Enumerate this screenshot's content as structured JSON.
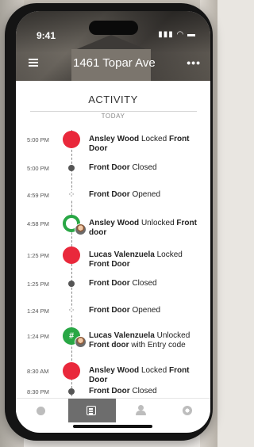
{
  "status_bar": {
    "time": "9:41",
    "icons": "▮▮▮ ◠ ▬"
  },
  "header": {
    "address": "1461 Topar Ave",
    "more": "•••"
  },
  "activity": {
    "title": "ACTIVITY",
    "section_label": "TODAY",
    "events": [
      {
        "time": "5:00 PM",
        "actor": "Ansley Wood",
        "action": "Locked",
        "target": "Front Door",
        "marker": "red"
      },
      {
        "time": "5:00 PM",
        "target": "Front Door",
        "action": "Closed",
        "marker": "small-dot"
      },
      {
        "time": "4:59 PM",
        "target": "Front Door",
        "action": "Opened",
        "marker": "dotted"
      },
      {
        "time": "4:58 PM",
        "actor": "Ansley Wood",
        "action": "Unlocked",
        "target": "Front door",
        "marker": "green-ring"
      },
      {
        "time": "1:25 PM",
        "actor": "Lucas Valenzuela",
        "action": "Locked",
        "target": "Front Door",
        "marker": "red"
      },
      {
        "time": "1:25 PM",
        "target": "Front Door",
        "action": "Closed",
        "marker": "small-dot"
      },
      {
        "time": "1:24 PM",
        "target": "Front Door",
        "action": "Opened",
        "marker": "dotted"
      },
      {
        "time": "1:24 PM",
        "actor": "Lucas Valenzuela",
        "action": "Unlocked",
        "target": "Front door",
        "suffix": "with Entry code",
        "marker": "green-code"
      },
      {
        "time": "8:30 AM",
        "actor": "Ansley Wood",
        "action": "Locked",
        "target": "Front Door",
        "marker": "red"
      },
      {
        "time": "8:30 PM",
        "target": "Front Door",
        "action": "Closed",
        "marker": "small-dot"
      }
    ]
  },
  "bottom_nav": {
    "items": [
      {
        "name": "home",
        "icon": "home-dot-icon"
      },
      {
        "name": "activity",
        "icon": "list-icon",
        "active": true
      },
      {
        "name": "guests",
        "icon": "users-icon"
      },
      {
        "name": "settings",
        "icon": "gear-icon"
      }
    ]
  },
  "colors": {
    "locked": "#e9283b",
    "unlocked": "#29a745",
    "active_tab": "#6d6d6d"
  }
}
